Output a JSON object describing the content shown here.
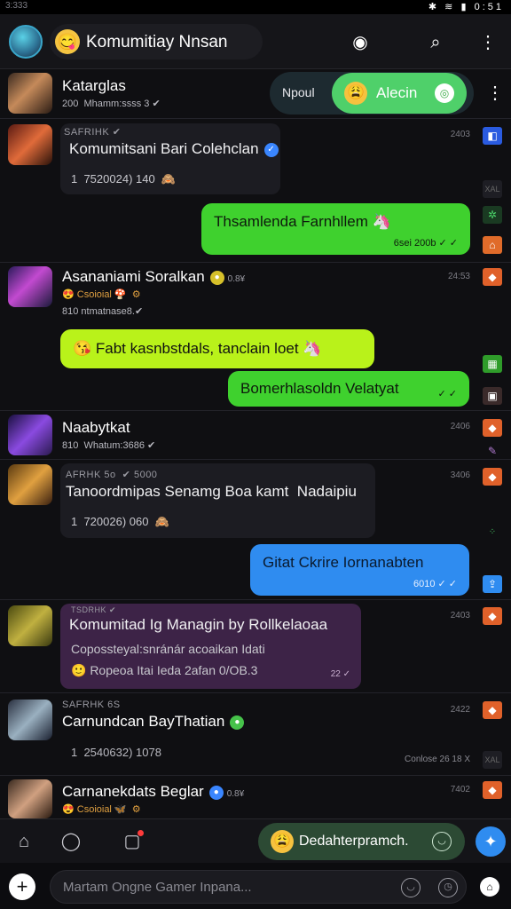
{
  "status_bar": {
    "time": "3:333",
    "battery_time": "0:51"
  },
  "header": {
    "title": "Komumitiay Nnsan",
    "title_emoji": "😋",
    "icons": [
      "camera-icon",
      "search-icon",
      "more-vert-icon"
    ]
  },
  "top_action": {
    "left_label": "Npoul",
    "main_label": "Alecin",
    "emoji": "😩"
  },
  "rows": [
    {
      "name": "Katarglas",
      "meta": "200  Mhamm:ssss 3 ✔"
    },
    {
      "tag": "SAFRIHK ✔",
      "card_title": "Komumitsani Bari Colehclan",
      "card_sub": "1  7520024) 140  🙈",
      "time": "2403"
    },
    {
      "bubble": "Thsamlenda Farnhllem 🦄",
      "bubble_stamp": "6sei 200b ✓ ✓",
      "time": ""
    },
    {
      "name": "Asananiami Soralkan",
      "badge_text": "0.8¥",
      "sub1": "😍 Csoioial 🍄  ⚙",
      "meta": "810 ntmatnase8.✔",
      "time": "24:53"
    },
    {
      "bubble": "😘 Fabt kasnbstdals, tanclain loet 🦄"
    },
    {
      "bubble": "Bomerhlasoldn Velatyat",
      "bubble_stamp": "✓ ✓"
    },
    {
      "name": "Naabytkat",
      "meta": "810  Whatum:3686 ✔",
      "time": "2406"
    },
    {
      "tag": "AFRHK 5o  ✔ 5000",
      "card_title": "Tanoordmipas Senamg Boa kamt  Nadaipiu",
      "card_sub": "1  720026) 060  🙈",
      "time": "3406"
    },
    {
      "bubble": "Gitat Ckrire Iornanabten",
      "bubble_stamp": "6010 ✓ ✓"
    },
    {
      "tag": "TSDRHK ✔",
      "card_title": "Komumitad Ig Managin by Rollkelaoaa",
      "card_sub1": "Copossteyal:snránár acoaikan Idati",
      "card_sub2": "🙂 Ropeoa Itai Ieda 2afan 0/OB.3",
      "card_stamp": "22 ✓",
      "time": "2403"
    },
    {
      "tag": "SAFRHK 6S",
      "name": "Carnundcan BayThatian",
      "card_sub": "1  2540632) 1078",
      "meta_right": "Conlose 26 18 X",
      "time": "2422"
    },
    {
      "name": "Carnanekdats Beglar",
      "badge_text": "0.8¥",
      "sub1": "😍 Csoioial 🦋  ⚙",
      "time": "7402"
    }
  ],
  "composer_emoji_label": "Dedahterpramch.",
  "composer_placeholder": "Martam Ongne Gamer Inpana...",
  "colors": {
    "green_bubble": "#3fd12e",
    "lime_bubble": "#b9f21a",
    "blue_bubble": "#2f8cf0",
    "purple_card": "#3d2347",
    "accent_orange": "#ff6a1a"
  }
}
